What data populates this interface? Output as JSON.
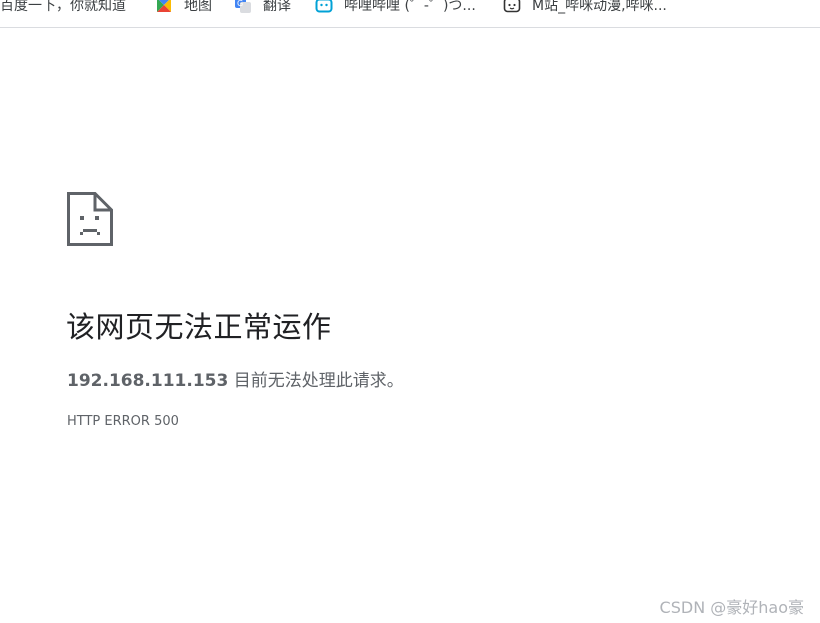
{
  "bookmarks": [
    {
      "label": "百度一下，你就知道",
      "icon": "baidu-icon"
    },
    {
      "label": "地图",
      "icon": "map-icon"
    },
    {
      "label": "翻译",
      "icon": "translate-icon"
    },
    {
      "label": "哔哩哔哩 (゜-゜)つ...",
      "icon": "bilibili-icon"
    },
    {
      "label": "M站_哔咪动漫,哔咪...",
      "icon": "acfun-icon"
    }
  ],
  "error": {
    "icon": "sad-document-icon",
    "title": "该网页无法正常运作",
    "host": "192.168.111.153",
    "message": " 目前无法处理此请求。",
    "code": "HTTP ERROR 500"
  },
  "watermark": "CSDN @豪好hao豪",
  "colors": {
    "title": "#202124",
    "text": "#5f6368",
    "icon": "#5f6368"
  }
}
